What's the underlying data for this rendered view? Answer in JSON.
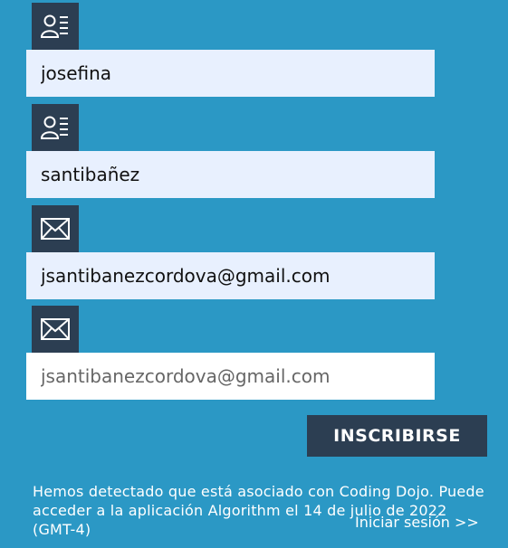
{
  "form": {
    "first_name": {
      "value": "josefina",
      "icon": "contact-card-icon"
    },
    "last_name": {
      "value": "santibañez",
      "icon": "contact-card-icon"
    },
    "email": {
      "value": "jsantibanezcordova@gmail.com",
      "icon": "envelope-icon"
    },
    "email_confirm": {
      "value": "jsantibanezcordova@gmail.com",
      "icon": "envelope-icon"
    },
    "submit_label": "INSCRIBIRSE"
  },
  "notice": "Hemos detectado que está asociado con Coding Dojo. Puede acceder a la aplicación Algorithm el 14 de julio de 2022 (GMT-4)",
  "login_link": "Iniciar sesión >>",
  "colors": {
    "background": "#2b98c5",
    "icon_box": "#2c3e52",
    "autofill_field": "#e8f0fe",
    "field": "#ffffff",
    "button": "#2c3e52"
  }
}
